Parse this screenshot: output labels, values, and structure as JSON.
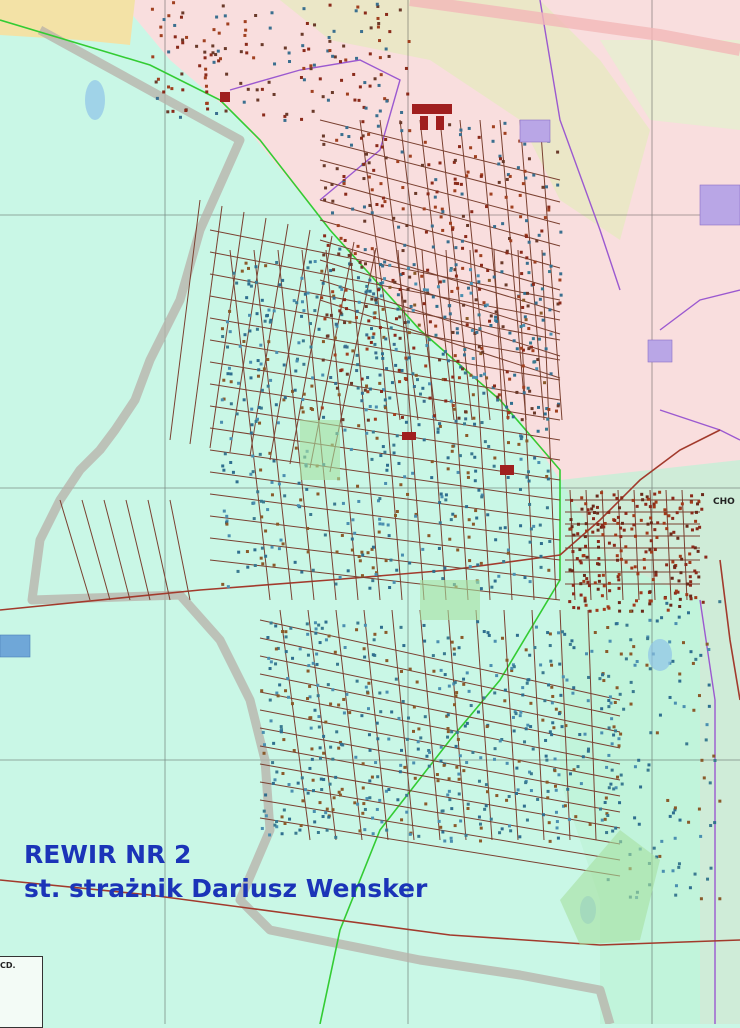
{
  "caption": {
    "line1": "REWIR NR 2",
    "line2": "st. strażnik Dariusz Wensker"
  },
  "labels": {
    "town_edge": "CHO",
    "legend_fragment": "CD."
  },
  "colors": {
    "district_fill": "#c9f7e6",
    "outside_fill": "#f9dede",
    "forest_fill": "#e9e8c4",
    "caption_text": "#1b34b8",
    "road": "#7a4030",
    "boundary_green": "#33cc33",
    "boundary_purple": "#9b59d0",
    "outer_boundary": "#b7b0a8"
  }
}
